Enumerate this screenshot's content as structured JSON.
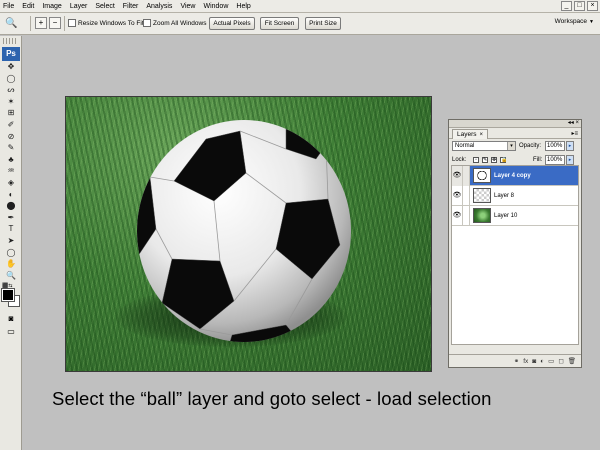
{
  "menu": [
    "File",
    "Edit",
    "Image",
    "Layer",
    "Select",
    "Filter",
    "Analysis",
    "View",
    "Window",
    "Help"
  ],
  "window_controls": [
    "_",
    "□",
    "×"
  ],
  "options": {
    "tool_glyph": "🔍",
    "zoom_in": "+",
    "zoom_out": "−",
    "resize_windows": "Resize Windows To Fit",
    "zoom_all": "Zoom All Windows",
    "buttons": [
      "Actual Pixels",
      "Fit Screen",
      "Print Size"
    ],
    "workspace": "Workspace",
    "workspace_arrow": "▼"
  },
  "tools": {
    "logo": "Ps",
    "glyphs": [
      "✥",
      "◯",
      "ᔕ",
      "✶",
      "⊞",
      "✐",
      "⊘",
      "✎",
      "♣",
      "♒",
      "◈",
      "◐",
      "⬤",
      "✒",
      "T",
      "➤",
      "◯",
      "✋",
      "🔍"
    ],
    "names": [
      "move-tool-icon",
      "marquee-tool-icon",
      "lasso-tool-icon",
      "magic-wand-icon",
      "crop-tool-icon",
      "slice-tool-icon",
      "healing-brush-icon",
      "brush-tool-icon",
      "clone-stamp-icon",
      "history-brush-icon",
      "eraser-tool-icon",
      "gradient-tool-icon",
      "blur-tool-icon",
      "pen-tool-icon",
      "type-tool-icon",
      "path-selection-icon",
      "shape-tool-icon",
      "hand-tool-icon",
      "zoom-tool-icon"
    ],
    "mini_colors": "⬛⇆",
    "quick_mask": "◙",
    "screen_mode": "▭"
  },
  "instruction": "Select the “ball” layer and goto select - load selection",
  "layers_panel": {
    "collapse": "◂◂ ×",
    "tab": "Layers",
    "tab_close": "×",
    "menu": "▸≡",
    "blend_mode": "Normal",
    "dropdown_arrow": "▾",
    "opacity_label": "Opacity:",
    "opacity": "100%",
    "fill_label": "Fill:",
    "fill": "100%",
    "arrow": "▸",
    "lock_label": "Lock:",
    "lock_icons": [
      "▫",
      "✎",
      "✥",
      "🔒"
    ],
    "layers": [
      {
        "name": "Layer 4 copy",
        "thumb": "ball",
        "selected": true
      },
      {
        "name": "Layer 8",
        "thumb": "trans",
        "selected": false
      },
      {
        "name": "Layer 10",
        "thumb": "grass",
        "selected": false
      }
    ],
    "eye": "👁",
    "footer": [
      "⚭",
      "fx",
      "◙",
      "◐",
      "▭",
      "◻",
      "🗑"
    ]
  }
}
